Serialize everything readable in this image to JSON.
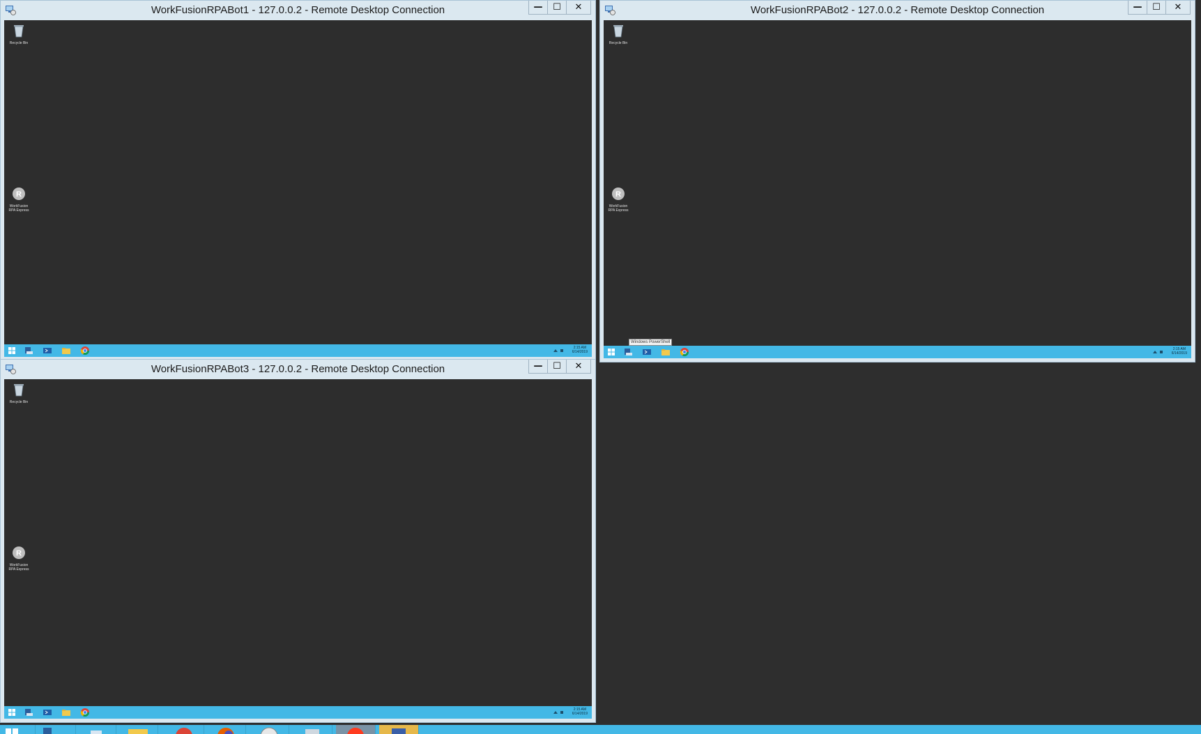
{
  "windows": [
    {
      "title": "WorkFusionRPABot1 - 127.0.0.2 - Remote Desktop Connection",
      "controls": {
        "minimize": "—",
        "maximize": "☐",
        "close": "✕"
      },
      "desktop_icons": [
        {
          "label": "Recycle Bin"
        },
        {
          "label": "WorkFusion RPA Express"
        }
      ],
      "clock": {
        "time": "2:15 AM",
        "date": "6/14/2019"
      }
    },
    {
      "title": "WorkFusionRPABot2 - 127.0.0.2 - Remote Desktop Connection",
      "controls": {
        "minimize": "—",
        "maximize": "☐",
        "close": "✕"
      },
      "desktop_icons": [
        {
          "label": "Recycle Bin"
        },
        {
          "label": "WorkFusion RPA Express"
        }
      ],
      "tooltip": "Windows PowerShell",
      "clock": {
        "time": "2:15 AM",
        "date": "6/14/2019"
      }
    },
    {
      "title": "WorkFusionRPABot3 - 127.0.0.2 - Remote Desktop Connection",
      "controls": {
        "minimize": "—",
        "maximize": "☐",
        "close": "✕"
      },
      "desktop_icons": [
        {
          "label": "Recycle Bin"
        },
        {
          "label": "WorkFusion RPA Express"
        }
      ],
      "clock": {
        "time": "2:15 AM",
        "date": "6/14/2019"
      }
    }
  ],
  "remote_taskbar_icons": [
    "windows-start-icon",
    "server-manager-icon",
    "powershell-icon",
    "file-explorer-icon",
    "chrome-icon"
  ],
  "host_taskbar_icons": [
    "windows-start-icon",
    "server-manager-icon",
    "powershell-icon",
    "file-explorer-icon",
    "chrome-icon",
    "firefox-icon",
    "clock-app-icon",
    "remote-desktop-icon",
    "recording-app-icon",
    "sticky-app-icon"
  ],
  "colors": {
    "taskbar": "#43b8e6",
    "desktop": "#2d2d2d",
    "title_bar": "#dbe8f0"
  }
}
